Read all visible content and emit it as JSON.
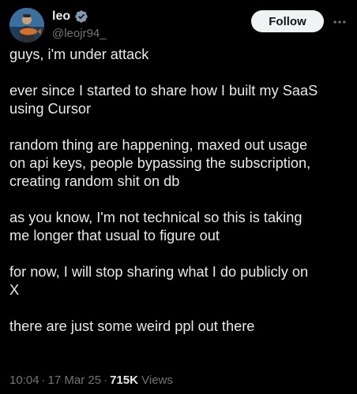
{
  "author": {
    "display_name": "leo",
    "handle": "@leojr94_",
    "verified": true
  },
  "follow_label": "Follow",
  "tweet": {
    "paragraphs": [
      "guys, i'm under attack",
      "ever since I started to share how I built my SaaS\nusing Cursor",
      "random thing are happening, maxed out usage\non api keys, people bypassing the subscription,\ncreating random shit on db",
      "as you know, I'm not technical so this is taking\nme longer that usual to figure out",
      "for now, I will stop sharing what I do publicly on\nX",
      "there are just some weird ppl out there"
    ]
  },
  "meta": {
    "time": "10:04",
    "date": "17 Mar 25",
    "separator": "·",
    "views_count": "715K",
    "views_label": "Views"
  },
  "colors": {
    "background": "#000000",
    "text": "#e7e9ea",
    "secondary": "#71767b",
    "verified_badge": "#829aab",
    "follow_bg": "#eff3f4"
  },
  "icons": [
    "verified-badge-icon",
    "more-options-icon"
  ]
}
